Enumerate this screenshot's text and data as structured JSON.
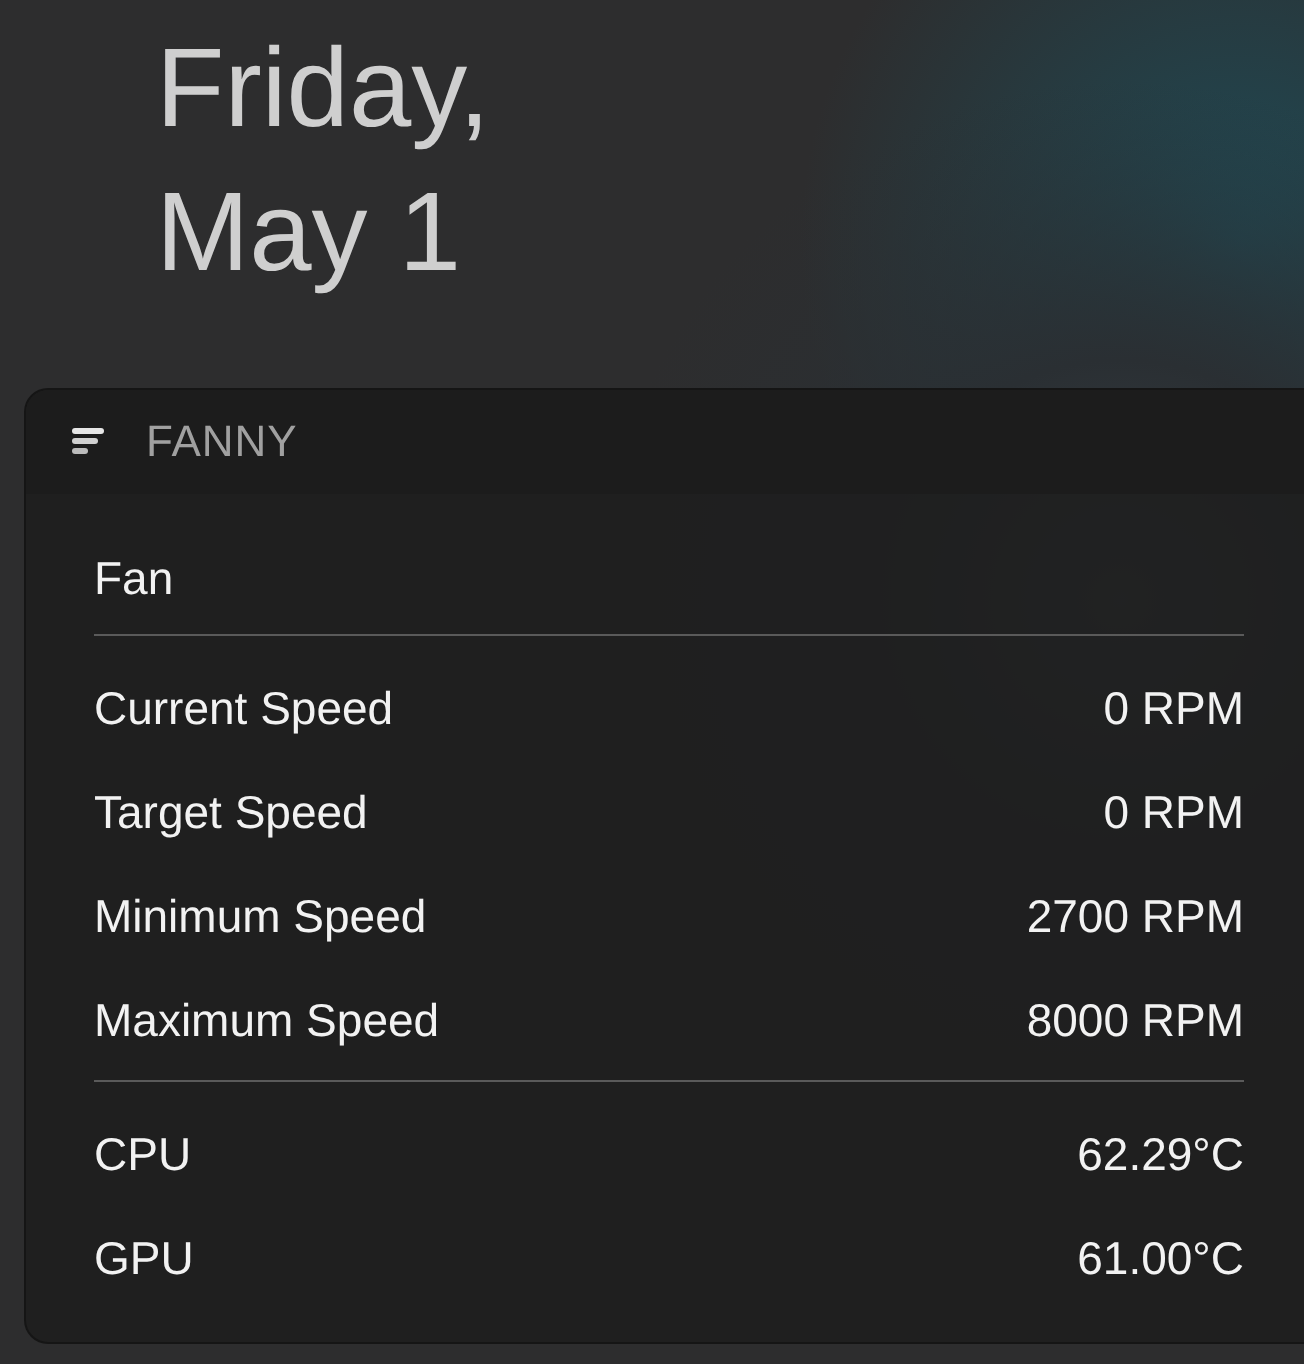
{
  "date": [
    "Friday,",
    "May 1"
  ],
  "widget": {
    "title": "FANNY",
    "section_title": "Fan",
    "groups": [
      [
        {
          "label": "Current Speed",
          "value": "0 RPM"
        },
        {
          "label": "Target Speed",
          "value": "0 RPM"
        },
        {
          "label": "Minimum Speed",
          "value": "2700 RPM"
        },
        {
          "label": "Maximum Speed",
          "value": "8000 RPM"
        }
      ],
      [
        {
          "label": "CPU",
          "value": "62.29°C"
        },
        {
          "label": "GPU",
          "value": "61.00°C"
        }
      ]
    ]
  }
}
